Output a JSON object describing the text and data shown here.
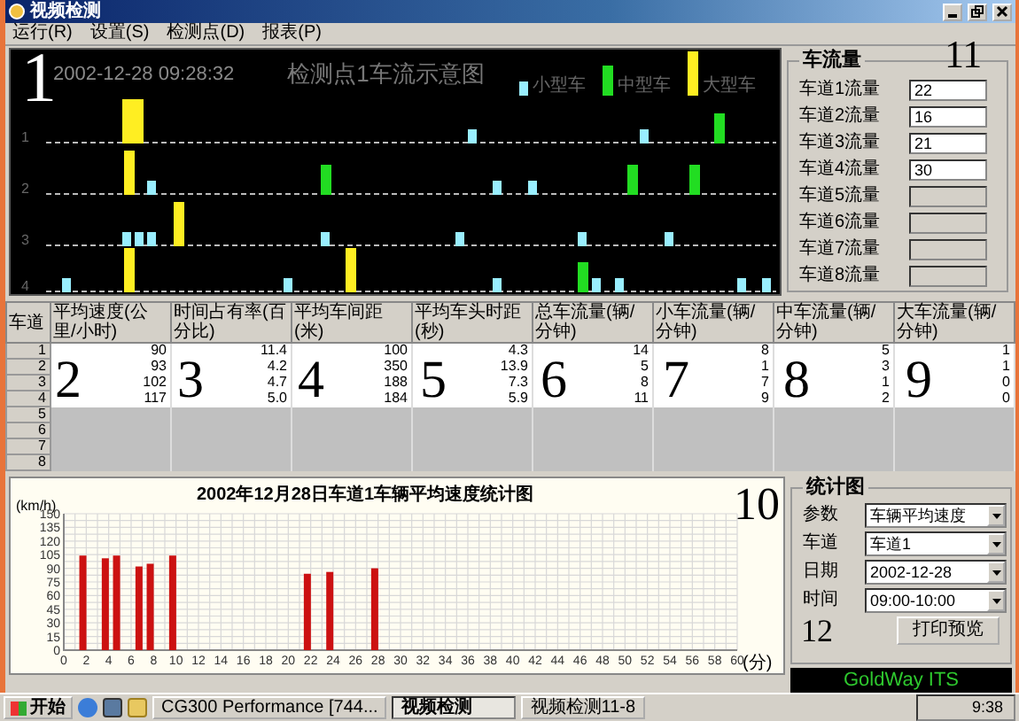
{
  "window": {
    "title": "视频检测"
  },
  "menu": [
    {
      "label": "运行(R)"
    },
    {
      "label": "设置(S)"
    },
    {
      "label": "检测点(D)"
    },
    {
      "label": "报表(P)"
    }
  ],
  "monitor": {
    "timestamp": "2002-12-28 09:28:32",
    "title": "检测点1车流示意图",
    "legend": [
      {
        "label": "小型车",
        "color": "#99eeff"
      },
      {
        "label": "中型车",
        "color": "#22dd22"
      },
      {
        "label": "大型车",
        "color": "#ffee22"
      }
    ],
    "lanes": [
      {
        "label": "1"
      },
      {
        "label": "2"
      },
      {
        "label": "3"
      },
      {
        "label": "4"
      }
    ]
  },
  "flow_panel": {
    "title": "车流量",
    "rows": [
      {
        "label": "车道1流量",
        "value": "22",
        "disabled": false
      },
      {
        "label": "车道2流量",
        "value": "16",
        "disabled": false
      },
      {
        "label": "车道3流量",
        "value": "21",
        "disabled": false
      },
      {
        "label": "车道4流量",
        "value": "30",
        "disabled": false
      },
      {
        "label": "车道5流量",
        "disabled": true
      },
      {
        "label": "车道6流量",
        "disabled": true
      },
      {
        "label": "车道7流量",
        "disabled": true
      },
      {
        "label": "车道8流量",
        "disabled": true
      }
    ]
  },
  "table": {
    "columns": [
      "车道",
      "平均速度(公里/小时)",
      "时间占有率(百分比)",
      "平均车间距(米)",
      "平均车头时距(秒)",
      "总车流量(辆/分钟)",
      "小车流量(辆/分钟)",
      "中车流量(辆/分钟)",
      "大车流量(辆/分钟)"
    ],
    "rows": [
      {
        "lane": "1",
        "cells": [
          "90",
          "11.4",
          "100",
          "4.3",
          "14",
          "8",
          "5",
          "1"
        ]
      },
      {
        "lane": "2",
        "cells": [
          "93",
          "4.2",
          "350",
          "13.9",
          "5",
          "1",
          "3",
          "1"
        ]
      },
      {
        "lane": "3",
        "cells": [
          "102",
          "4.7",
          "188",
          "7.3",
          "8",
          "7",
          "1",
          "0"
        ]
      },
      {
        "lane": "4",
        "cells": [
          "117",
          "5.0",
          "184",
          "5.9",
          "11",
          "9",
          "2",
          "0"
        ]
      },
      {
        "lane": "5"
      },
      {
        "lane": "6"
      },
      {
        "lane": "7"
      },
      {
        "lane": "8"
      }
    ]
  },
  "chart": {
    "chart_data": {
      "type": "bar",
      "title": "2002年12月28日车道1车辆平均速度统计图",
      "xlabel": "(分)",
      "ylabel": "(km/h)",
      "x": [
        1.7,
        3.7,
        4.7,
        6.7,
        7.7,
        9.7,
        21.7,
        23.7,
        27.7
      ],
      "values": [
        104,
        101,
        104,
        92,
        95,
        104,
        84,
        86,
        90
      ],
      "xlim": [
        0,
        60
      ],
      "ylim": [
        0,
        150
      ],
      "xticks": [
        0,
        2,
        4,
        6,
        8,
        10,
        12,
        14,
        16,
        18,
        20,
        22,
        24,
        26,
        28,
        30,
        32,
        34,
        36,
        38,
        40,
        42,
        44,
        46,
        48,
        50,
        52,
        54,
        56,
        58,
        60
      ],
      "yticks": [
        0,
        15,
        30,
        45,
        60,
        75,
        90,
        105,
        120,
        135,
        150
      ],
      "grid": true
    }
  },
  "stats_panel": {
    "title": "统计图",
    "fields": [
      {
        "label": "参数",
        "value": "车辆平均速度"
      },
      {
        "label": "车道",
        "value": "车道1"
      },
      {
        "label": "日期",
        "value": "2002-12-28"
      },
      {
        "label": "时间",
        "value": "09:00-10:00"
      }
    ],
    "button": "打印预览",
    "brand": "GoldWay ITS"
  },
  "taskbar": {
    "start": "开始",
    "tasks": [
      {
        "label": "CG300 Performance [744...",
        "selected": false
      },
      {
        "label": "视频检测",
        "selected": true
      },
      {
        "label": "视频检测11-8",
        "selected": false
      }
    ],
    "clock": "9:38"
  },
  "callouts": [
    "1",
    "2",
    "3",
    "4",
    "5",
    "6",
    "7",
    "8",
    "9",
    "10",
    "11",
    "12"
  ]
}
